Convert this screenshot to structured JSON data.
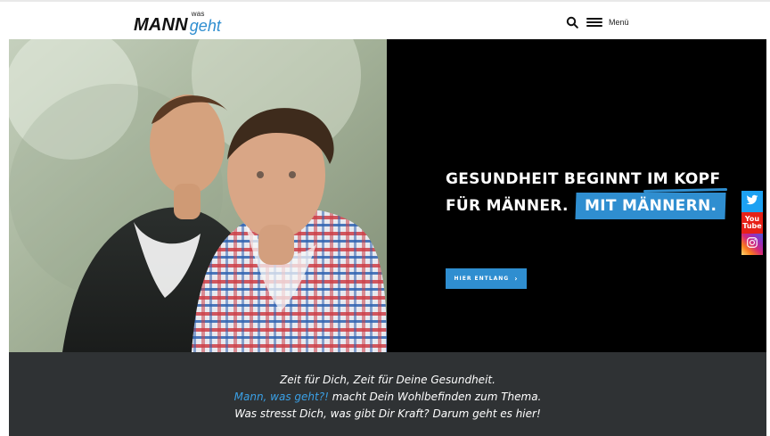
{
  "header": {
    "logo": {
      "main": "MANN",
      "small": "was",
      "script": "geht"
    },
    "search_icon": "search-icon",
    "menu_icon": "hamburger-icon",
    "menu_label": "Menü"
  },
  "hero": {
    "headline_line1_prefix": "GESUNDHEIT BEGINNT",
    "headline_line1_underlined": "IM KOPF",
    "headline_line2_prefix": "FÜR MÄNNER.",
    "headline_line2_highlight": "MIT MÄNNERN.",
    "cta_label": "HIER ENTLANG",
    "cta_chevron": "›"
  },
  "social": {
    "twitter_icon": "twitter-icon",
    "youtube_icon": "youtube-icon",
    "instagram_icon": "instagram-icon",
    "youtube_text_top": "You",
    "youtube_text_bottom": "Tube"
  },
  "band": {
    "line1": "Zeit für Dich, Zeit für Deine Gesundheit.",
    "line2_accent": "Mann, was geht?!",
    "line2_rest": " macht Dein Wohlbefinden zum Thema.",
    "line3": "Was stresst Dich, was gibt Dir Kraft? Darum geht es hier!"
  },
  "colors": {
    "accent": "#2f8ed0",
    "band_bg": "#2f3234",
    "hero_bg": "#000000"
  }
}
